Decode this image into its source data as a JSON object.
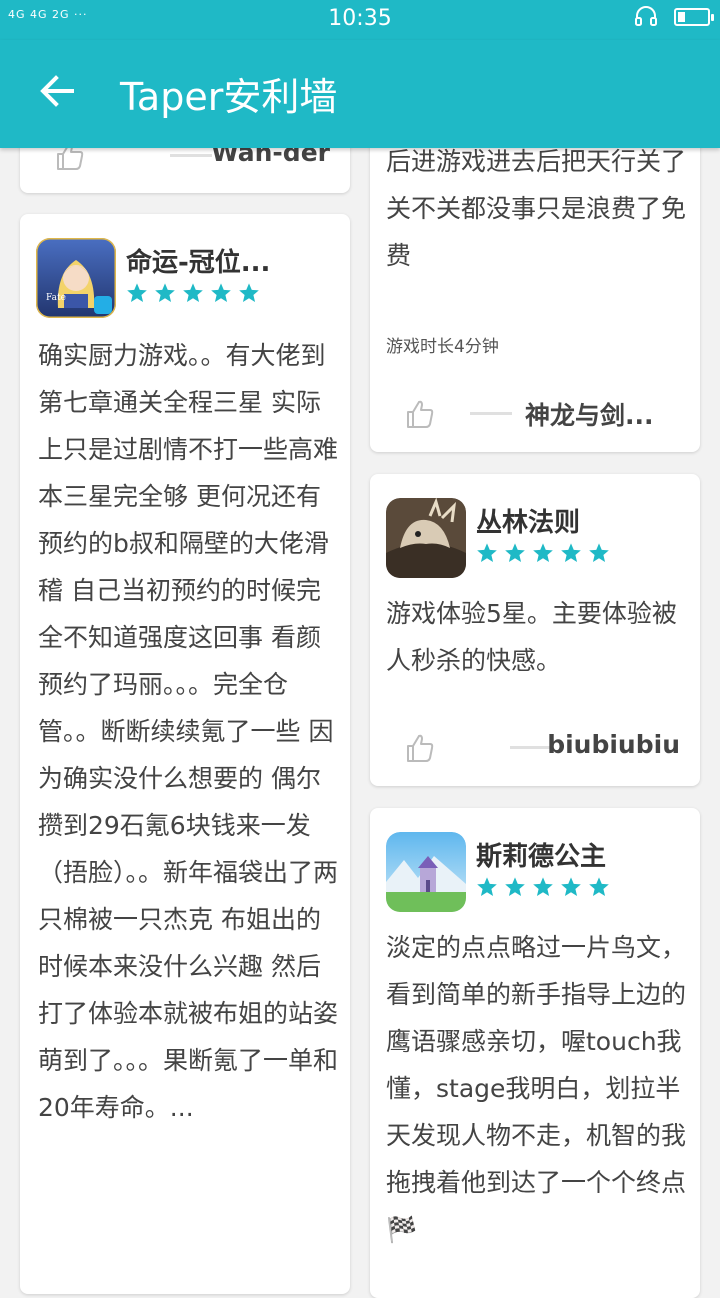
{
  "status_bar": {
    "signal_text": "4G 4G  2G ···",
    "time": "10:35",
    "battery_level": 0.25
  },
  "app_bar": {
    "back_icon": "arrow-left-icon",
    "title": "Taper安利墙"
  },
  "cards": {
    "top_left": {
      "author": "Wan-der"
    },
    "left_main": {
      "game_title": "命运-冠位...",
      "rating_stars": 5,
      "review": "确实厨力游戏。。有大佬到第七章通关全程三星 实际上只是过剧情不打一些高难本三星完全够 更何况还有预约的b叔和隔壁的大佬滑稽 自己当初预约的时候完全不知道强度这回事 看颜预约了玛丽。。。完全仓管。。断断续续氪了一些 因为确实没什么想要的 偶尔攒到29石氪6块钱来一发（捂脸）。。新年福袋出了两只棉被一只杰克 布姐出的时候本来没什么兴趣 然后打了体验本就被布姐的站姿萌到了。。。果断氪了一单和20年寿命。..."
    },
    "right_top": {
      "review_partial": "一个天行VPN点击连接然后进游戏进去后把天行关了关不关都没事只是浪费了免费",
      "playtime": "游戏时长4分钟",
      "author": "神龙与剑..."
    },
    "right_middle": {
      "game_title": "丛林法则",
      "rating_stars": 5,
      "review": "游戏体验5星。主要体验被人秒杀的快感。",
      "author": "biubiubiu"
    },
    "right_bottom": {
      "game_title": "斯莉德公主",
      "rating_stars": 5,
      "review": "淡定的点点略过一片鸟文，看到简单的新手指导上边的鹰语骤感亲切，喔touch我懂，stage我明白，划拉半天发现人物不走，机智的我拖拽着他到达了一个个终点🏁"
    }
  },
  "colors": {
    "accent": "#1fb9c6",
    "star": "#1fb9c6",
    "background": "#f2f2f2"
  }
}
